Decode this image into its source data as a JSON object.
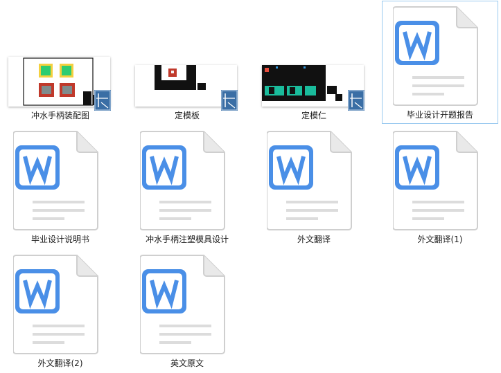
{
  "files": [
    {
      "name": "冲水手柄装配图",
      "type": "dwg",
      "icon": "cad-drawing-icon"
    },
    {
      "name": "定模板",
      "type": "dwg",
      "icon": "cad-drawing-icon"
    },
    {
      "name": "定模仁",
      "type": "dwg",
      "icon": "cad-drawing-icon"
    },
    {
      "name": "毕业设计开题报告",
      "type": "docx",
      "icon": "word-document-icon",
      "selected": true
    },
    {
      "name": "毕业设计说明书",
      "type": "docx",
      "icon": "word-document-icon"
    },
    {
      "name": "冲水手柄注塑模具设计",
      "type": "docx",
      "icon": "word-document-icon"
    },
    {
      "name": "外文翻译",
      "type": "docx",
      "icon": "word-document-icon"
    },
    {
      "name": "外文翻译(1)",
      "type": "docx",
      "icon": "word-document-icon"
    },
    {
      "name": "外文翻译(2)",
      "type": "docx",
      "icon": "word-document-icon"
    },
    {
      "name": "英文原文",
      "type": "docx",
      "icon": "word-document-icon"
    }
  ],
  "colors": {
    "word_blue": "#4a8fe7",
    "selection_border": "#99c9ef",
    "cad_badge": "#3a6ea5"
  }
}
